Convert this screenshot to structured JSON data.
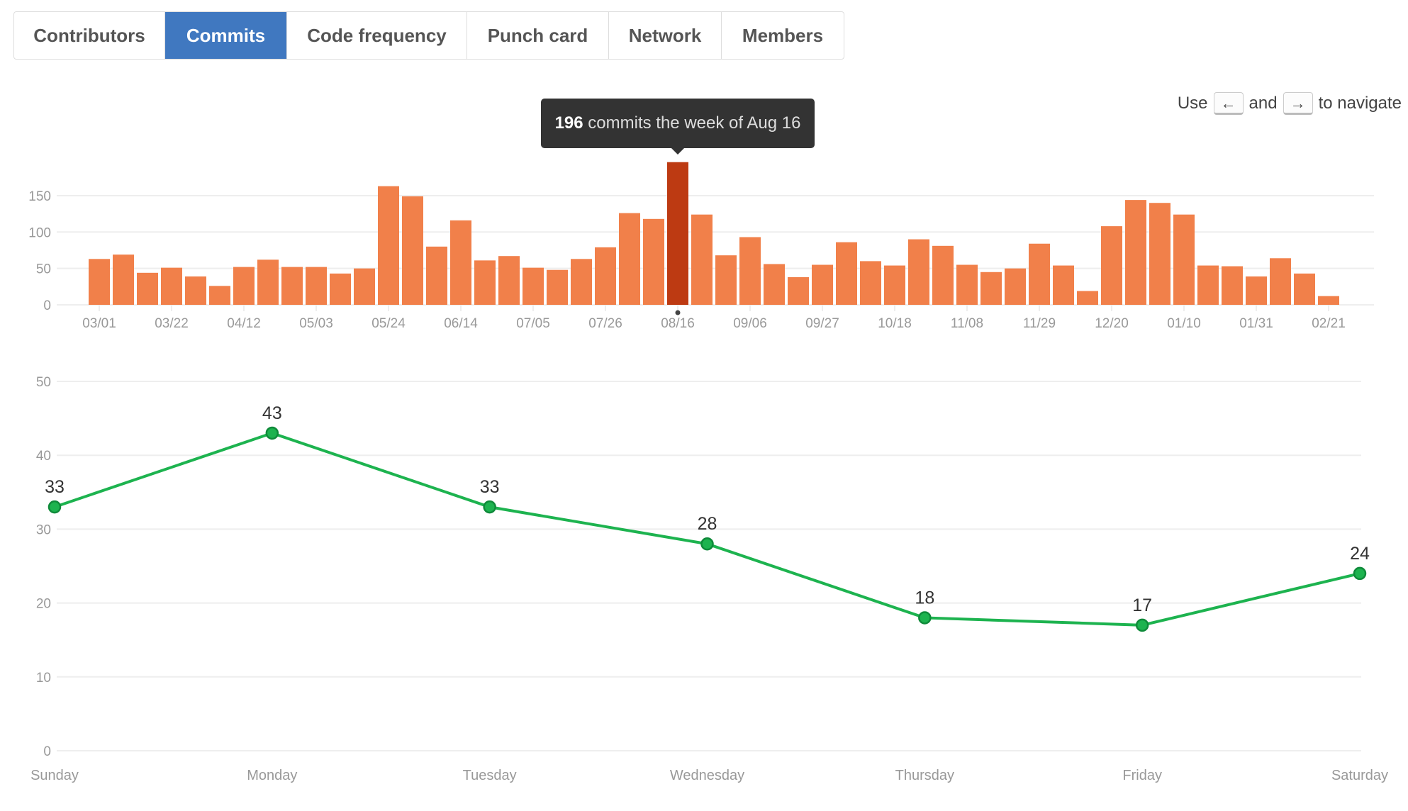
{
  "tabs": [
    {
      "label": "Contributors",
      "active": false
    },
    {
      "label": "Commits",
      "active": true
    },
    {
      "label": "Code frequency",
      "active": false
    },
    {
      "label": "Punch card",
      "active": false
    },
    {
      "label": "Network",
      "active": false
    },
    {
      "label": "Members",
      "active": false
    }
  ],
  "nav_hint": {
    "use": "Use",
    "left_key": "←",
    "and": "and",
    "right_key": "→",
    "suffix": "to navigate"
  },
  "tooltip": {
    "count": "196",
    "text": "commits the week of Aug 16"
  },
  "colors": {
    "bar": "#f1804a",
    "bar_highlight": "#bd3a12",
    "line": "#1db34f",
    "point": "#1db34f",
    "tab_active": "#4078c0"
  },
  "chart_data": [
    {
      "type": "bar",
      "title": "",
      "ylim": [
        0,
        196
      ],
      "yticks": [
        0,
        50,
        100,
        150
      ],
      "grid": true,
      "xtick_labels": [
        "03/01",
        "03/22",
        "04/12",
        "05/03",
        "05/24",
        "06/14",
        "07/05",
        "07/26",
        "08/16",
        "09/06",
        "09/27",
        "10/18",
        "11/08",
        "11/29",
        "12/20",
        "01/10",
        "01/31",
        "02/21"
      ],
      "highlighted_index": 24,
      "values": [
        63,
        69,
        44,
        51,
        39,
        26,
        52,
        62,
        52,
        52,
        43,
        50,
        163,
        149,
        80,
        116,
        61,
        67,
        51,
        48,
        63,
        79,
        126,
        118,
        196,
        124,
        68,
        93,
        56,
        38,
        55,
        86,
        60,
        54,
        90,
        81,
        55,
        45,
        50,
        84,
        54,
        19,
        108,
        144,
        140,
        124,
        54,
        53,
        39,
        64,
        43,
        12
      ]
    },
    {
      "type": "line",
      "title": "",
      "ylim": [
        0,
        50
      ],
      "yticks": [
        0,
        10,
        20,
        30,
        40,
        50
      ],
      "grid": true,
      "categories": [
        "Sunday",
        "Monday",
        "Tuesday",
        "Wednesday",
        "Thursday",
        "Friday",
        "Saturday"
      ],
      "values": [
        33,
        43,
        33,
        28,
        18,
        17,
        24
      ]
    }
  ]
}
